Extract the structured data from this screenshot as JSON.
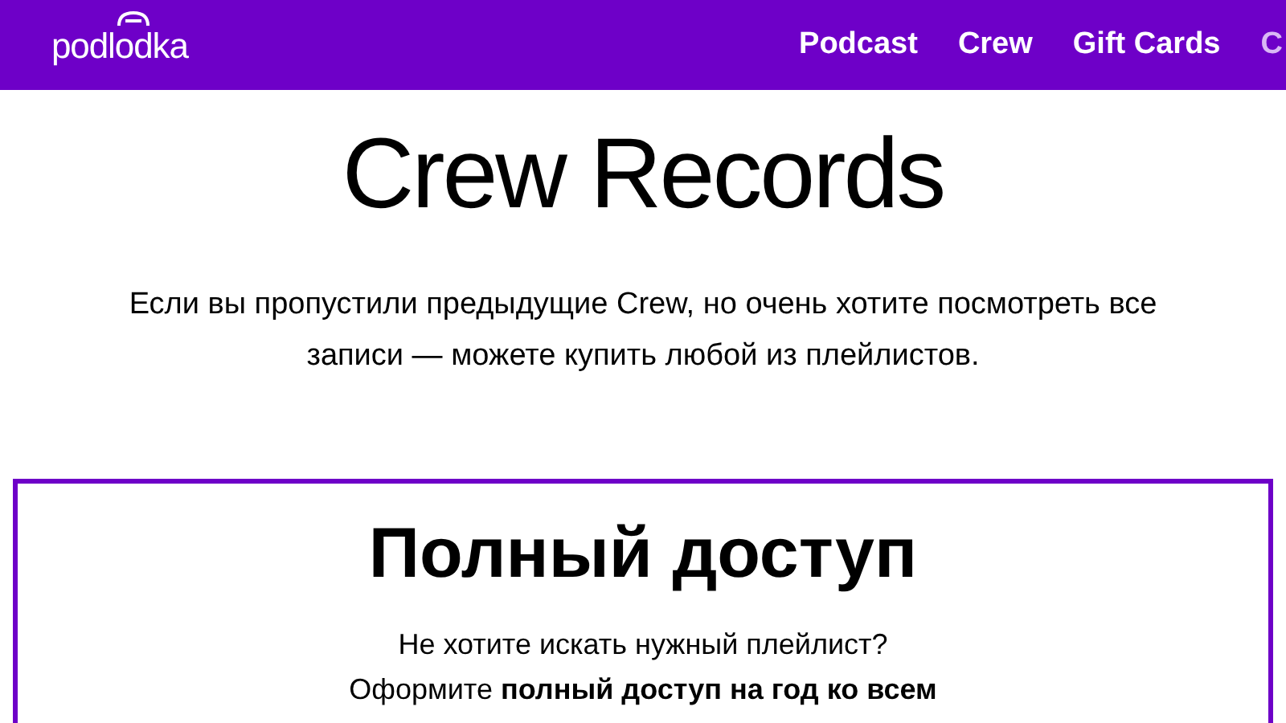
{
  "header": {
    "logo": "podlodka",
    "nav": [
      {
        "label": "Podcast"
      },
      {
        "label": "Crew"
      },
      {
        "label": "Gift Cards"
      },
      {
        "label": "C"
      }
    ]
  },
  "title": "Crew Records",
  "intro": "Если вы пропустили предыдущие Crew, но очень хотите посмотреть все записи — можете купить любой из плейлистов.",
  "card": {
    "heading": "Полный доступ",
    "lines": [
      "Не хотите искать нужный плейлист?",
      "Оформите **полный доступ на год ко всем**"
    ]
  }
}
